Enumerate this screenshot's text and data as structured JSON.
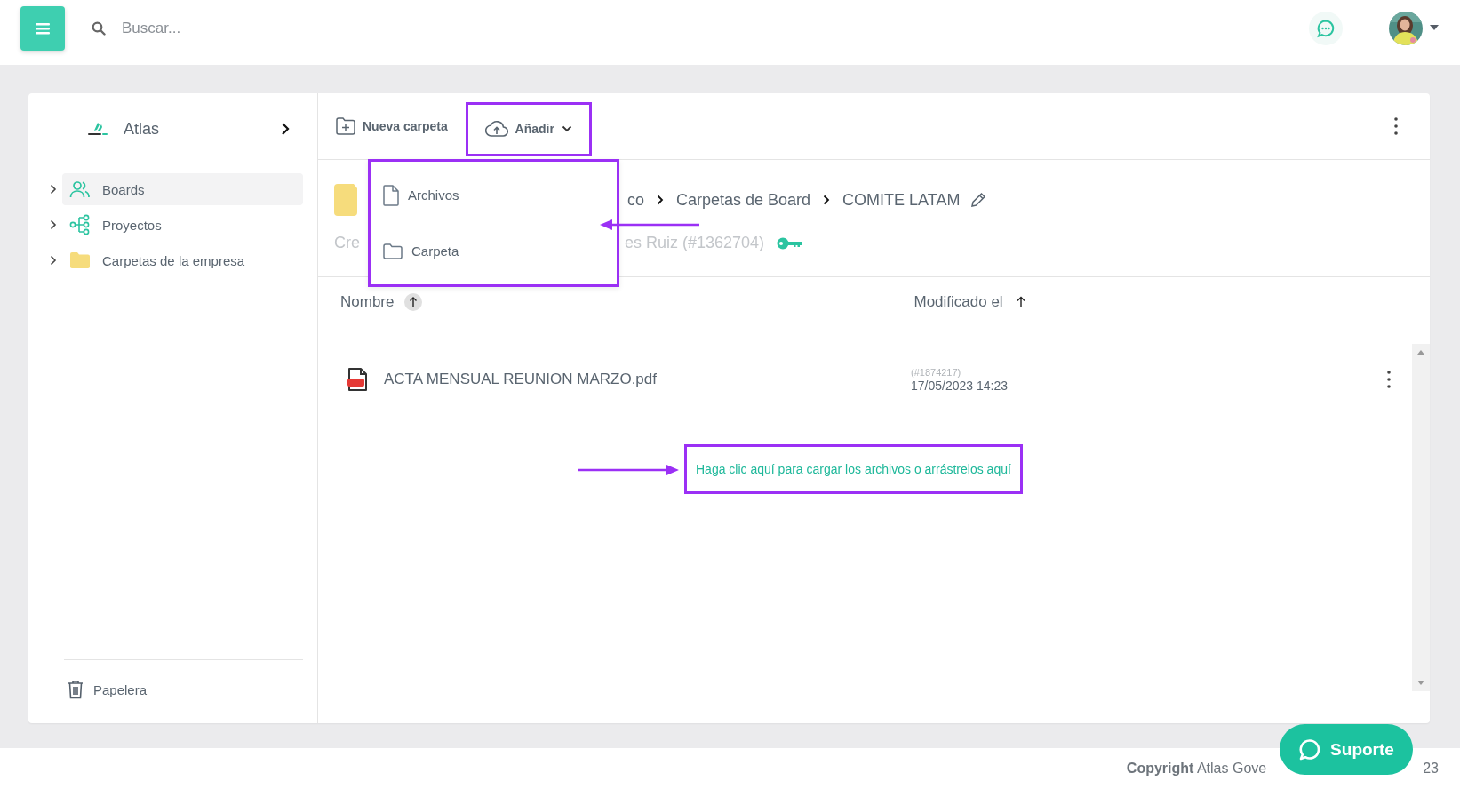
{
  "topbar": {
    "search": {
      "placeholder": "Buscar..."
    }
  },
  "sidebar": {
    "title": "Atlas",
    "items": [
      {
        "label": "Boards",
        "selected": true,
        "kind": "people"
      },
      {
        "label": "Proyectos",
        "selected": false,
        "kind": "tree"
      },
      {
        "label": "Carpetas de la empresa",
        "selected": false,
        "kind": "folder"
      }
    ],
    "trash": "Papelera"
  },
  "toolbar": {
    "new_folder": "Nueva carpeta",
    "add": "Añadir"
  },
  "dropdown": {
    "items": [
      {
        "label": "Archivos",
        "kind": "file"
      },
      {
        "label": "Carpeta",
        "kind": "folder"
      }
    ]
  },
  "header": {
    "breadcrumb": [
      "co",
      "Carpetas de Board",
      "COMITE LATAM"
    ],
    "meta_start": "Cre",
    "meta_end": "es Ruiz (#1362704)"
  },
  "table": {
    "columns": [
      "Nombre",
      "Modificado el"
    ],
    "rows": [
      {
        "name": "ACTA MENSUAL REUNION MARZO.pdf",
        "id": "(#1874217)",
        "modified": "17/05/2023 14:23"
      }
    ]
  },
  "upload_hint": "Haga clic aquí para cargar los archivos o arrástrelos aquí",
  "footer": {
    "copyright": "**Copyright** Atlas Gove",
    "copyright_end": "23"
  },
  "support_button": "Suporte"
}
